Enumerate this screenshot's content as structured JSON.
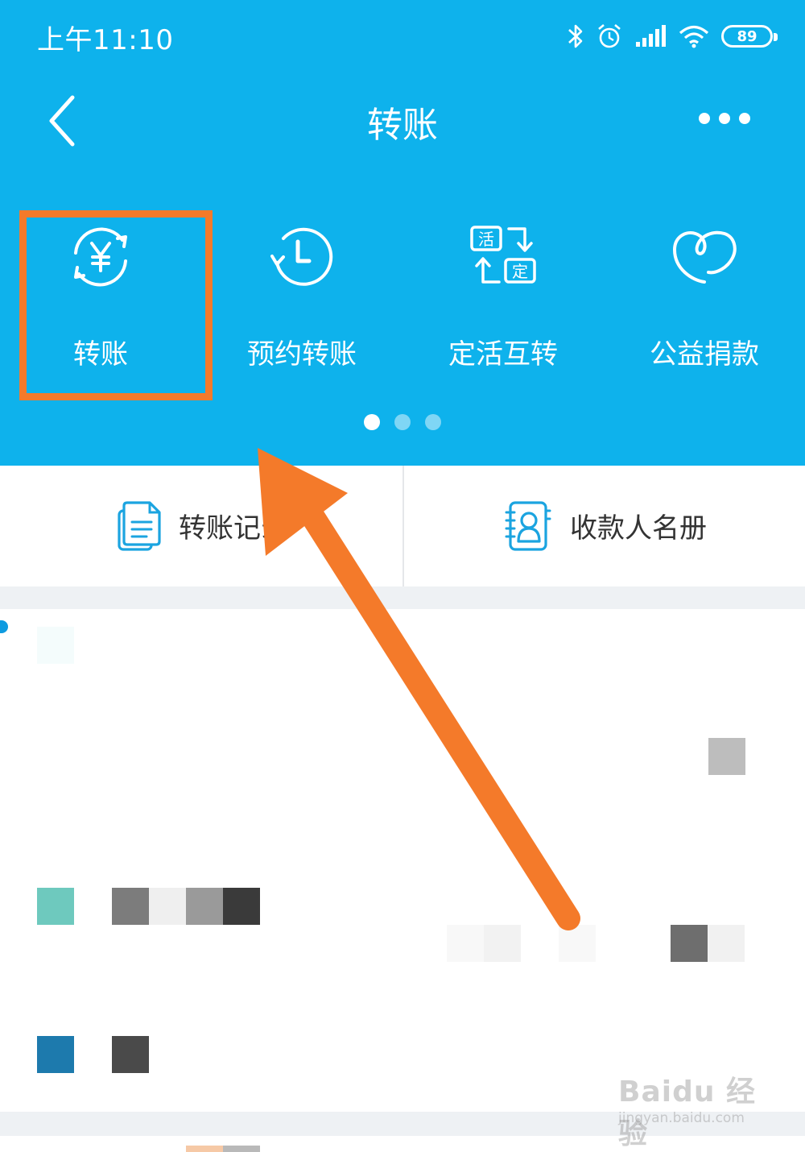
{
  "status_bar": {
    "time": "上午11:10",
    "battery": "89"
  },
  "nav": {
    "title": "转账"
  },
  "features": [
    {
      "label": "转账",
      "icon": "yuan-cycle-icon"
    },
    {
      "label": "预约转账",
      "icon": "clock-icon"
    },
    {
      "label": "定活互转",
      "icon": "fixed-current-swap-icon"
    },
    {
      "label": "公益捐款",
      "icon": "heart-icon"
    }
  ],
  "pager": {
    "pages": 3,
    "active": 1
  },
  "shortcuts": [
    {
      "label": "转账记录",
      "icon": "document-icon"
    },
    {
      "label": "收款人名册",
      "icon": "contact-book-icon"
    }
  ],
  "watermark": {
    "brand": "Baidu 经验",
    "url": "jingyan.baidu.com"
  },
  "colors": {
    "header": "#0eb2ec",
    "highlight": "#f47a2a",
    "accent_icon": "#1ba4e0"
  }
}
